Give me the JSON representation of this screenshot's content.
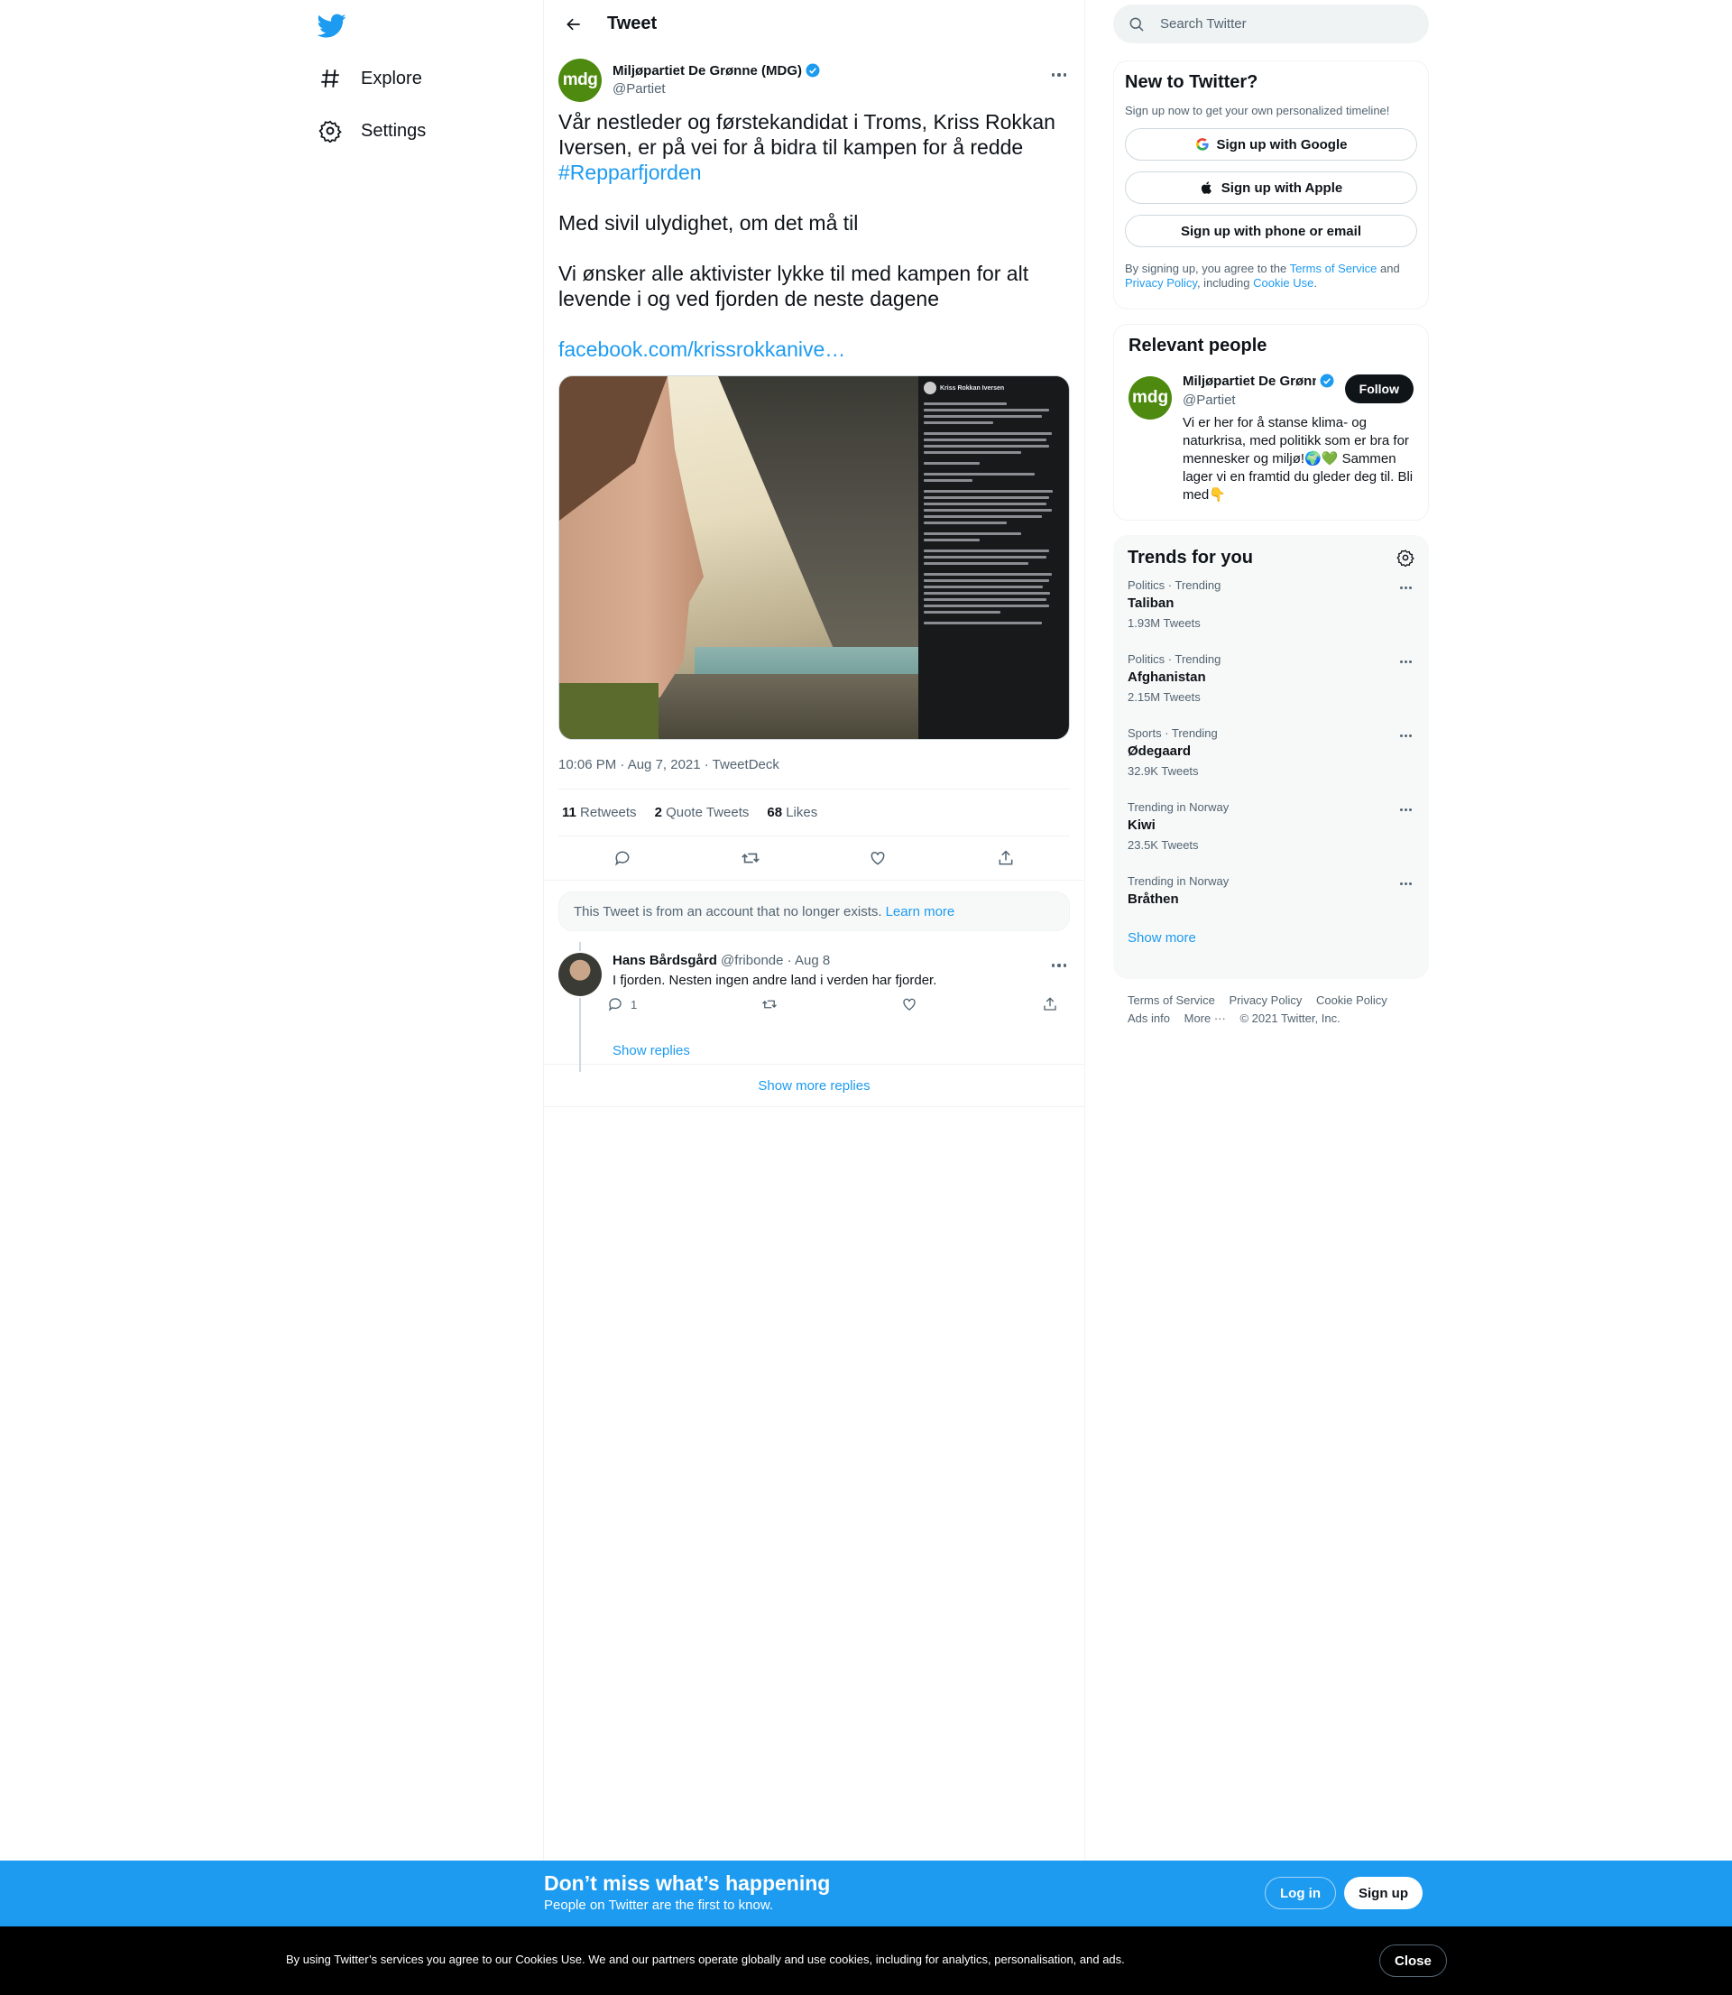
{
  "nav": {
    "items": [
      {
        "label": "Explore",
        "icon": "hashtag-icon"
      },
      {
        "label": "Settings",
        "icon": "gear-icon"
      }
    ]
  },
  "header": {
    "title": "Tweet"
  },
  "tweet": {
    "author_name": "Miljøpartiet De Grønne (MDG)",
    "author_handle": "@Partiet",
    "avatar_text": "mdg",
    "paragraph1_text": "Vår nestleder og førstekandidat i Troms, Kriss Rokkan Iversen, er på vei for å bidra til kampen for å redde ",
    "hashtag": "#Repparfjorden",
    "paragraph2": "Med sivil ulydighet, om det må til",
    "paragraph3": "Vi ønsker alle aktivister lykke til med kampen for alt levende i og ved fjorden de neste dagene",
    "link": "facebook.com/krissrokkanive…",
    "media_post_author": "Kriss Rokkan Iversen",
    "timestamp": "10:06 PM · Aug 7, 2021 · TweetDeck",
    "retweets_count": "11",
    "retweets_label": "Retweets",
    "quotes_count": "2",
    "quotes_label": "Quote Tweets",
    "likes_count": "68",
    "likes_label": "Likes"
  },
  "notice": {
    "text": "This Tweet is from an account that no longer exists.",
    "link": "Learn more"
  },
  "reply": {
    "name": "Hans Bårdsgård",
    "handle": "@fribonde",
    "date": "· Aug 8",
    "text": "I fjorden. Nesten ingen andre land i verden har fjorder.",
    "reply_count": "1",
    "show_replies": "Show replies"
  },
  "show_more_replies": "Show more replies",
  "search": {
    "placeholder": "Search Twitter"
  },
  "new_to_twitter": {
    "title": "New to Twitter?",
    "subtitle": "Sign up now to get your own personalized timeline!",
    "google": "Sign up with Google",
    "apple": "Sign up with Apple",
    "phone": "Sign up with phone or email",
    "legal_prefix": "By signing up, you agree to the ",
    "terms": "Terms of Service",
    "and": " and ",
    "privacy": "Privacy Policy",
    "including": ", including ",
    "cookie": "Cookie Use",
    "period": "."
  },
  "relevant": {
    "title": "Relevant people",
    "name": "Miljøpartiet De Grønne (MDG)",
    "handle": "@Partiet",
    "follow": "Follow",
    "bio": "Vi er her for å stanse klima- og naturkrisa, med politikk som er bra for mennesker og miljø!🌍💚 Sammen lager vi en framtid du gleder deg til. Bli med👇"
  },
  "trends": {
    "title": "Trends for you",
    "items": [
      {
        "context": "Politics · Trending",
        "name": "Taliban",
        "count": "1.93M Tweets"
      },
      {
        "context": "Politics · Trending",
        "name": "Afghanistan",
        "count": "2.15M Tweets"
      },
      {
        "context": "Sports · Trending",
        "name": "Ødegaard",
        "count": "32.9K Tweets"
      },
      {
        "context": "Trending in Norway",
        "name": "Kiwi",
        "count": "23.5K Tweets"
      },
      {
        "context": "Trending in Norway",
        "name": "Bråthen",
        "count": ""
      }
    ],
    "show_more": "Show more"
  },
  "footer": {
    "terms": "Terms of Service",
    "privacy": "Privacy Policy",
    "cookie": "Cookie Policy",
    "ads": "Ads info",
    "more": "More ···",
    "copyright": "© 2021 Twitter, Inc."
  },
  "signup_bar": {
    "title": "Don’t miss what’s happening",
    "subtitle": "People on Twitter are the first to know.",
    "login": "Log in",
    "signup": "Sign up"
  },
  "cookie_bar": {
    "text": "By using Twitter’s services you agree to our Cookies Use. We and our partners operate globally and use cookies, including for analytics, personalisation, and ads.",
    "close": "Close"
  },
  "colors": {
    "accent": "#1d9bf0",
    "mdg_green": "#4d8a0f",
    "text": "#0f1419",
    "secondary": "#536471"
  }
}
